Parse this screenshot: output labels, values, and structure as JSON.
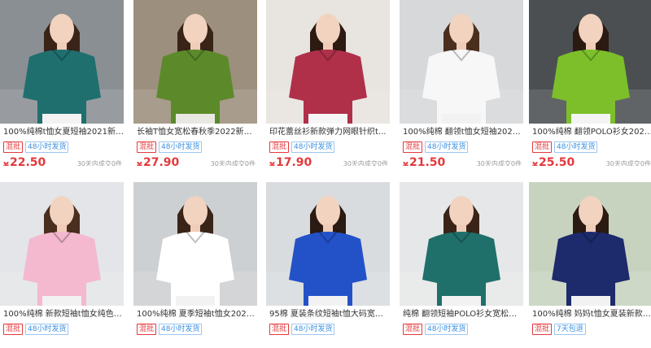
{
  "products": [
    {
      "title": "100%纯棉t恤女夏短袖2021新款...",
      "tag_primary": "混批",
      "tag_secondary": "48小时发货",
      "currency": "¥",
      "price": "22.50",
      "sales": "30天内成交0件",
      "colors": {
        "bg": "#8a8f93",
        "shirt": "#1f6f6f",
        "pants": "#f2f2f2",
        "hair": "#3a2418"
      }
    },
    {
      "title": "长袖T恤女宽松春秋季2022新款...",
      "tag_primary": "混批",
      "tag_secondary": "48小时发货",
      "currency": "¥",
      "price": "27.90",
      "sales": "30天内成交0件",
      "colors": {
        "bg": "#9c8f7d",
        "shirt": "#5c8a2b",
        "pants": "#e9e7e2",
        "hair": "#3a2418"
      }
    },
    {
      "title": "印花蕾丝衫新款弹力网眼针织t...",
      "tag_primary": "混批",
      "tag_secondary": "48小时发货",
      "currency": "¥",
      "price": "17.90",
      "sales": "30天内成交0件",
      "colors": {
        "bg": "#e8e4df",
        "shirt": "#b0304a",
        "pants": "#f6f6f6",
        "hair": "#2d1a12"
      }
    },
    {
      "title": "100%纯棉 翻领t恤女短袖2021夏...",
      "tag_primary": "混批",
      "tag_secondary": "48小时发货",
      "currency": "¥",
      "price": "21.50",
      "sales": "30天内成交0件",
      "colors": {
        "bg": "#d6d8da",
        "shirt": "#f7f7f7",
        "pants": "#f2f2f2",
        "hair": "#4a2e1e"
      }
    },
    {
      "title": "100%纯棉 翻领POLO衫女2021...",
      "tag_primary": "混批",
      "tag_secondary": "48小时发货",
      "currency": "¥",
      "price": "25.50",
      "sales": "30天内成交0件",
      "colors": {
        "bg": "#4b4f52",
        "shirt": "#7cbf2a",
        "pants": "#f4f4f4",
        "hair": "#2b1a12"
      }
    },
    {
      "title": "100%纯棉 新款短袖t恤女纯色宽...",
      "tag_primary": "混批",
      "tag_secondary": "48小时发货",
      "currency": "¥",
      "price": "",
      "sales": "",
      "colors": {
        "bg": "#e3e5e8",
        "shirt": "#f4b9cf",
        "pants": "#f2f2f2",
        "hair": "#4a2e1e"
      }
    },
    {
      "title": "100%纯棉 夏季短袖t恤女2022新...",
      "tag_primary": "混批",
      "tag_secondary": "48小时发货",
      "currency": "¥",
      "price": "",
      "sales": "",
      "colors": {
        "bg": "#cdd0d2",
        "shirt": "#ffffff",
        "pants": "#f2f2f2",
        "hair": "#3a2418"
      }
    },
    {
      "title": "95棉 夏装条纹短袖t恤大码宽松...",
      "tag_primary": "混批",
      "tag_secondary": "48小时发货",
      "currency": "¥",
      "price": "",
      "sales": "",
      "colors": {
        "bg": "#d9dcdf",
        "shirt": "#2352c8",
        "pants": "#f2f2f2",
        "hair": "#2a1a12"
      }
    },
    {
      "title": "纯棉 翻领短袖POLO衫女宽松百...",
      "tag_primary": "混批",
      "tag_secondary": "48小时发货",
      "currency": "¥",
      "price": "",
      "sales": "",
      "colors": {
        "bg": "#e6e7e8",
        "shirt": "#1f6f6a",
        "pants": "#f2f2f2",
        "hair": "#3a2418"
      }
    },
    {
      "title": "100%纯棉 妈妈t恤女夏装新款绣...",
      "tag_primary": "混批",
      "tag_secondary": "7天包退",
      "currency": "¥",
      "price": "",
      "sales": "",
      "colors": {
        "bg": "#c7d3bf",
        "shirt": "#1d2a6b",
        "pants": "#f2f2f2",
        "hair": "#2b1a12"
      }
    }
  ]
}
